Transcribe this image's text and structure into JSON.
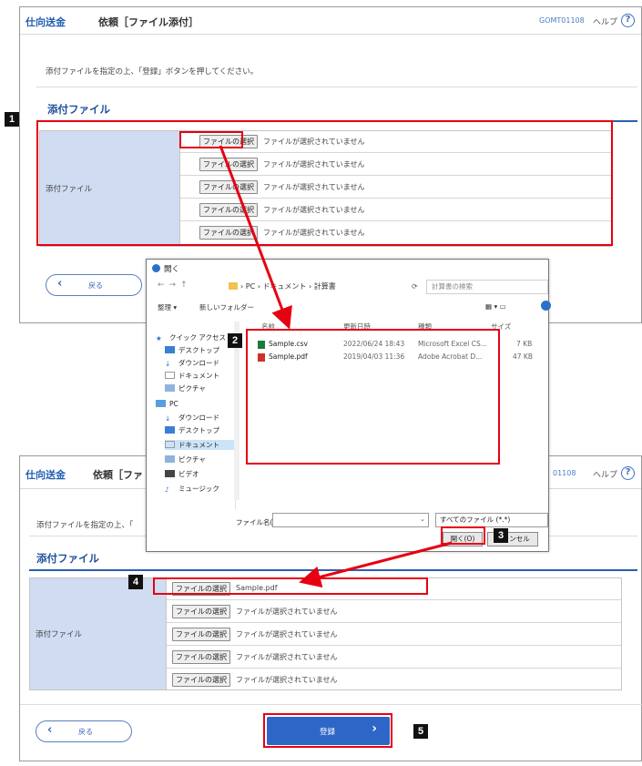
{
  "page": {
    "title_main": "仕向送金",
    "title_sub": "依頼［ファイル添付］",
    "title_sub_short": "依頼［ファ",
    "screen_code": "GOMT01108",
    "screen_code_partial": "01108",
    "help_label": "ヘルプ",
    "help_icon": "?",
    "instruction": "添付ファイルを指定の上、「登録」ボタンを押してください。",
    "instruction_partial": "添付ファイルを指定の上、「",
    "section_title": "添付ファイル",
    "field_label": "添付ファイル",
    "choose_file_label": "ファイルの選択",
    "no_file_text": "ファイルが選択されていません",
    "selected_file": "Sample.pdf",
    "back_label": "戻る",
    "register_label": "登録"
  },
  "dialog": {
    "title": "開く",
    "address": "› PC › ドキュメント › 計算書",
    "search_placeholder": "計算書の検索",
    "organize": "整理 ▾",
    "new_folder": "新しいフォルダー",
    "nav_items": [
      "クイック アクセス",
      "デスクトップ",
      "ダウンロード",
      "ドキュメント",
      "ピクチャ",
      "PC",
      "ダウンロード",
      "デスクトップ",
      "ドキュメント",
      "ピクチャ",
      "ビデオ",
      "ミュージック"
    ],
    "columns": [
      "名前",
      "更新日時",
      "種類",
      "サイズ"
    ],
    "files": [
      {
        "name": "Sample.csv",
        "date": "2022/06/24 18:43",
        "type": "Microsoft Excel CS...",
        "size": "7 KB"
      },
      {
        "name": "Sample.pdf",
        "date": "2019/04/03 11:36",
        "type": "Adobe Acrobat D...",
        "size": "47 KB"
      }
    ],
    "filename_label": "ファイル名(N):",
    "filetype": "すべてのファイル (*.*)",
    "open_label": "開く(O)",
    "cancel_label": "キャンセル"
  },
  "badges": [
    "1",
    "2",
    "3",
    "4",
    "5"
  ],
  "colors": {
    "annotation": "#e60012",
    "accent": "#2e66c7",
    "label_bg": "#cfdcf2"
  }
}
